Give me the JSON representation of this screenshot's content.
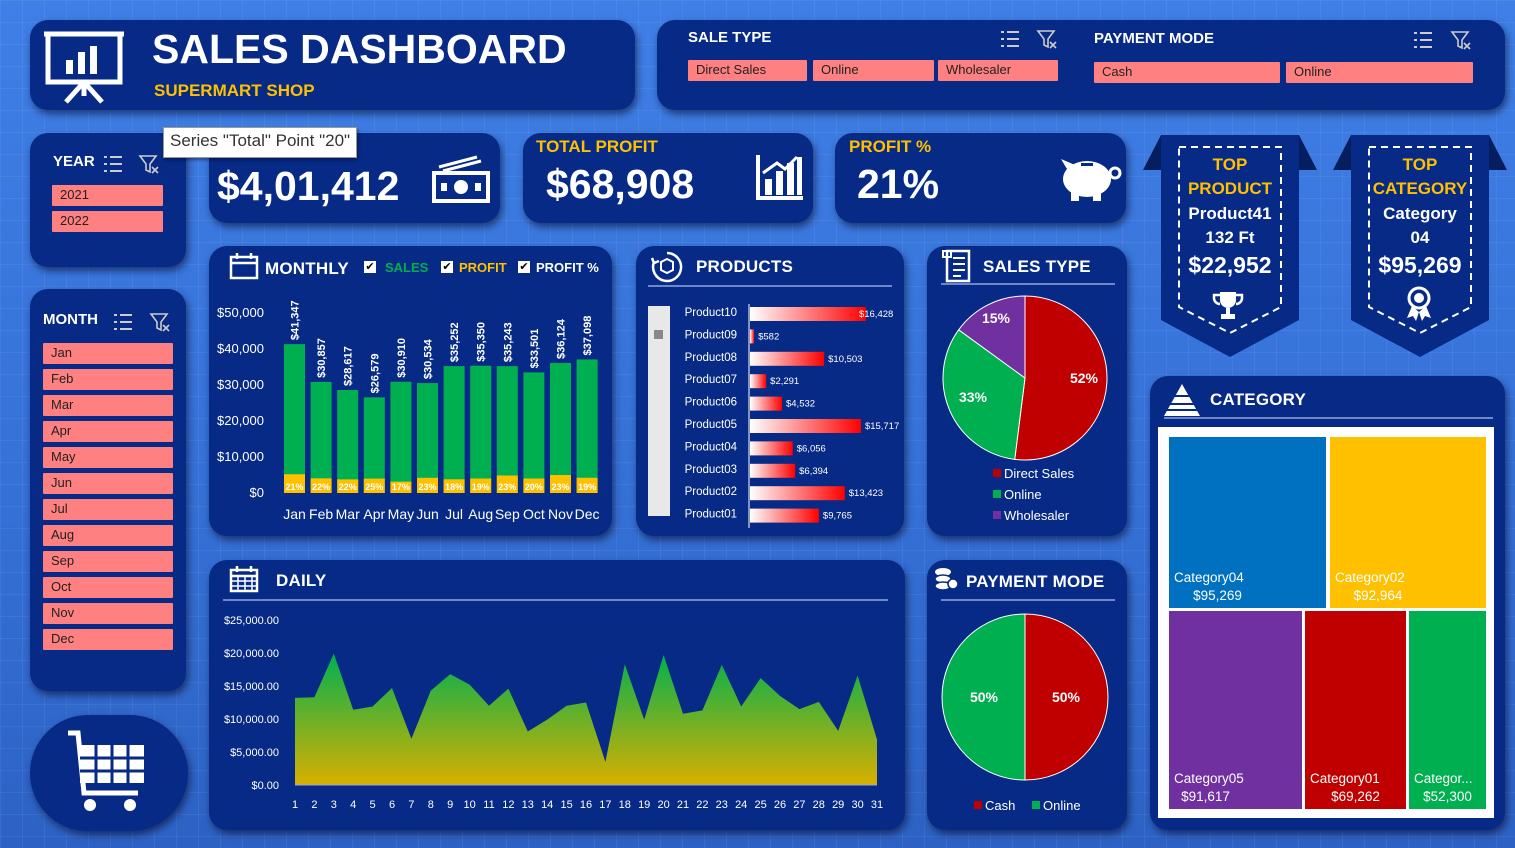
{
  "header": {
    "title": "SALES DASHBOARD",
    "subtitle": "SUPERMART SHOP"
  },
  "sale_type": {
    "label": "SALE TYPE",
    "items": [
      "Direct Sales",
      "Online",
      "Wholesaler"
    ]
  },
  "payment_mode": {
    "label": "PAYMENT MODE",
    "items": [
      "Cash",
      "Online"
    ]
  },
  "year": {
    "label": "YEAR",
    "items": [
      "2021",
      "2022"
    ]
  },
  "month": {
    "label": "MONTH",
    "items": [
      "Jan",
      "Feb",
      "Mar",
      "Apr",
      "May",
      "Jun",
      "Jul",
      "Aug",
      "Sep",
      "Oct",
      "Nov",
      "Dec"
    ]
  },
  "tooltip": "Series \"Total\" Point \"20\"",
  "kpi": {
    "sales_value": "$4,01,412",
    "profit_label": "TOTAL PROFIT",
    "profit_value": "$68,908",
    "pct_label": "PROFIT %",
    "pct_value": "21%"
  },
  "top_product": {
    "l1": "TOP",
    "l2": "PRODUCT",
    "name": "Product41",
    "qty": "132 Ft",
    "value": "$22,952"
  },
  "top_category": {
    "l1": "TOP",
    "l2": "CATEGORY",
    "name": "Category",
    "num": "04",
    "value": "$95,269"
  },
  "monthly": {
    "title": "MONTHLY",
    "legend": [
      "SALES",
      "PROFIT",
      "PROFIT %"
    ]
  },
  "products": {
    "title": "PRODUCTS"
  },
  "sales_type_chart": {
    "title": "SALES TYPE"
  },
  "daily": {
    "title": "DAILY"
  },
  "payment_chart": {
    "title": "PAYMENT MODE"
  },
  "category": {
    "title": "CATEGORY"
  },
  "colors": {
    "panel": "#062a86",
    "slicer": "#ff8080",
    "sales": "#00b050",
    "profit": "#ffc000",
    "red": "#c00000",
    "purple": "#7030a0"
  },
  "chart_data": [
    {
      "type": "bar",
      "name": "monthly",
      "categories": [
        "Jan",
        "Feb",
        "Mar",
        "Apr",
        "May",
        "Jun",
        "Jul",
        "Aug",
        "Sep",
        "Oct",
        "Nov",
        "Dec"
      ],
      "series": [
        {
          "name": "SALES",
          "values": [
            41347,
            30857,
            28617,
            26579,
            30910,
            30534,
            35252,
            35350,
            35243,
            33501,
            36124,
            37098
          ]
        },
        {
          "name": "PROFIT %",
          "values": [
            "21%",
            "22%",
            "22%",
            "25%",
            "17%",
            "23%",
            "18%",
            "19%",
            "23%",
            "20%",
            "23%",
            "19%"
          ]
        }
      ],
      "value_labels": [
        "$41,347",
        "$30,857",
        "$28,617",
        "$26,579",
        "$30,910",
        "$30,534",
        "$35,252",
        "$35,350",
        "$35,243",
        "$33,501",
        "$36,124",
        "$37,098"
      ],
      "yticks": [
        "$0",
        "$10,000",
        "$20,000",
        "$30,000",
        "$40,000",
        "$50,000"
      ],
      "ylim": [
        0,
        50000
      ]
    },
    {
      "type": "bar",
      "name": "products",
      "categories": [
        "Product10",
        "Product09",
        "Product08",
        "Product07",
        "Product06",
        "Product05",
        "Product04",
        "Product03",
        "Product02",
        "Product01"
      ],
      "values": [
        16428,
        582,
        10503,
        2291,
        4532,
        15717,
        6056,
        6394,
        13423,
        9765
      ],
      "labels": [
        "$16,428",
        "$582",
        "$10,503",
        "$2,291",
        "$4,532",
        "$15,717",
        "$6,056",
        "$6,394",
        "$13,423",
        "$9,765"
      ]
    },
    {
      "type": "pie",
      "name": "sales_type",
      "categories": [
        "Direct Sales",
        "Online",
        "Wholesaler"
      ],
      "values": [
        52,
        33,
        15
      ],
      "labels": [
        "52%",
        "33%",
        "15%"
      ],
      "colors": [
        "#c00000",
        "#00b050",
        "#7030a0"
      ]
    },
    {
      "type": "area",
      "name": "daily",
      "x": [
        1,
        2,
        3,
        4,
        5,
        6,
        7,
        8,
        9,
        10,
        11,
        12,
        13,
        14,
        15,
        16,
        17,
        18,
        19,
        20,
        21,
        22,
        23,
        24,
        25,
        26,
        27,
        28,
        29,
        30,
        31
      ],
      "values": [
        13200,
        13300,
        19900,
        11400,
        11900,
        14700,
        7000,
        14300,
        16800,
        15200,
        12000,
        14600,
        8100,
        9900,
        12000,
        12500,
        3500,
        18300,
        9900,
        19700,
        10800,
        11300,
        18200,
        11900,
        16200,
        13500,
        11500,
        12600,
        8200,
        16600,
        6900
      ],
      "yticks": [
        "$0.00",
        "$5,000.00",
        "$10,000.00",
        "$15,000.00",
        "$20,000.00",
        "$25,000.00"
      ],
      "ylim": [
        0,
        25000
      ]
    },
    {
      "type": "pie",
      "name": "payment_mode",
      "categories": [
        "Cash",
        "Online"
      ],
      "values": [
        50,
        50
      ],
      "labels": [
        "50%",
        "50%"
      ],
      "colors": [
        "#c00000",
        "#00b050"
      ]
    },
    {
      "type": "heatmap",
      "name": "category_treemap",
      "categories": [
        "Category04",
        "Category02",
        "Category05",
        "Category01",
        "Categor..."
      ],
      "values": [
        95269,
        92964,
        91617,
        69262,
        52300
      ],
      "labels": [
        "$95,269",
        "$92,964",
        "$91,617",
        "$69,262",
        "$52,300"
      ],
      "colors": [
        "#0070c0",
        "#ffc000",
        "#7030a0",
        "#c00000",
        "#00b050"
      ]
    }
  ]
}
